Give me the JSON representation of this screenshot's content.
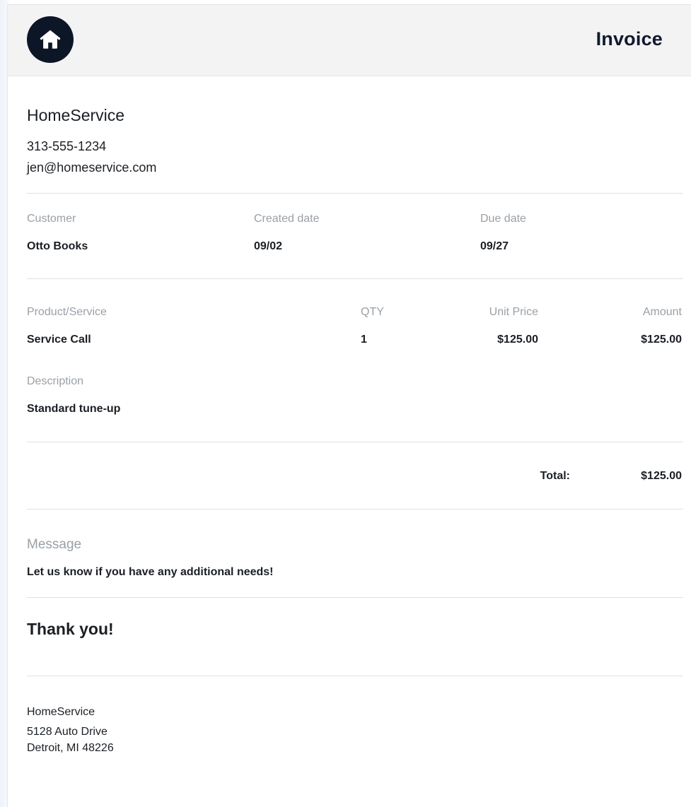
{
  "header": {
    "title": "Invoice",
    "logo_icon": "home-icon",
    "logo_bg": "#0d1626"
  },
  "company": {
    "name": "HomeService",
    "phone": "313-555-1234",
    "email": "jen@homeservice.com"
  },
  "meta": {
    "customer_label": "Customer",
    "customer": "Otto Books",
    "created_label": "Created date",
    "created": "09/02",
    "due_label": "Due date",
    "due": "09/27"
  },
  "items": {
    "headers": {
      "product": "Product/Service",
      "qty": "QTY",
      "unit_price": "Unit Price",
      "amount": "Amount"
    },
    "rows": [
      {
        "product": "Service Call",
        "qty": "1",
        "unit_price": "$125.00",
        "amount": "$125.00",
        "description_label": "Description",
        "description": "Standard tune-up"
      }
    ]
  },
  "totals": {
    "label": "Total:",
    "value": "$125.00"
  },
  "message": {
    "label": "Message",
    "text": "Let us know if you have any additional needs!"
  },
  "thanks": "Thank you!",
  "footer": {
    "name": "HomeService",
    "street": "5128 Auto Drive",
    "city": "Detroit, MI 48226"
  }
}
